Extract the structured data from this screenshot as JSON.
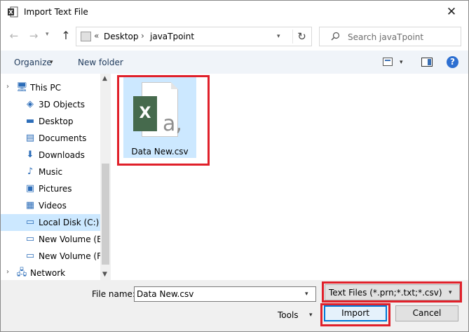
{
  "window": {
    "title": "Import Text File",
    "close_glyph": "✕"
  },
  "nav": {
    "back_glyph": "←",
    "forward_glyph": "→",
    "recent_glyph": "▾",
    "up_glyph": "↑",
    "overflow_glyph": "«",
    "breadcrumb": [
      "Desktop",
      "javaTpoint"
    ],
    "breadcrumb_separator": "›",
    "refresh_glyph": "↻",
    "search_placeholder": "Search javaTpoint"
  },
  "toolbar": {
    "organize_label": "Organize",
    "new_folder_label": "New folder",
    "help_glyph": "?"
  },
  "sidebar": {
    "items": [
      {
        "label": "This PC",
        "icon": "computer-icon",
        "glyph": "🖥",
        "level": 0,
        "expand": "›",
        "selected": false
      },
      {
        "label": "3D Objects",
        "icon": "3d-objects-icon",
        "glyph": "◈",
        "level": 1,
        "selected": false
      },
      {
        "label": "Desktop",
        "icon": "desktop-icon",
        "glyph": "▬",
        "level": 1,
        "selected": false
      },
      {
        "label": "Documents",
        "icon": "documents-icon",
        "glyph": "▤",
        "level": 1,
        "selected": false
      },
      {
        "label": "Downloads",
        "icon": "downloads-icon",
        "glyph": "⬇",
        "level": 1,
        "selected": false
      },
      {
        "label": "Music",
        "icon": "music-icon",
        "glyph": "♪",
        "level": 1,
        "selected": false
      },
      {
        "label": "Pictures",
        "icon": "pictures-icon",
        "glyph": "▣",
        "level": 1,
        "selected": false
      },
      {
        "label": "Videos",
        "icon": "videos-icon",
        "glyph": "▦",
        "level": 1,
        "selected": false
      },
      {
        "label": "Local Disk (C:)",
        "icon": "drive-icon",
        "glyph": "▭",
        "level": 1,
        "selected": true
      },
      {
        "label": "New Volume (E:)",
        "icon": "drive-icon",
        "glyph": "▭",
        "level": 1,
        "selected": false
      },
      {
        "label": "New Volume (F:)",
        "icon": "drive-icon",
        "glyph": "▭",
        "level": 1,
        "selected": false
      },
      {
        "label": "Network",
        "icon": "network-icon",
        "glyph": "🖧",
        "level": 0,
        "expand": "›",
        "selected": false
      }
    ]
  },
  "files": [
    {
      "name": "Data New.csv",
      "type_badge": "X",
      "type_glyph": "a,"
    }
  ],
  "footer": {
    "file_name_label": "File name:",
    "file_name_value": "Data New.csv",
    "file_type_filter": "Text Files (*.prn;*.txt;*.csv)",
    "tools_label": "Tools",
    "import_label": "Import",
    "cancel_label": "Cancel"
  },
  "colors": {
    "highlight_box": "#e0202a",
    "selection": "#cce8ff",
    "excel_green": "#466a4d",
    "accent": "#0078d7"
  }
}
